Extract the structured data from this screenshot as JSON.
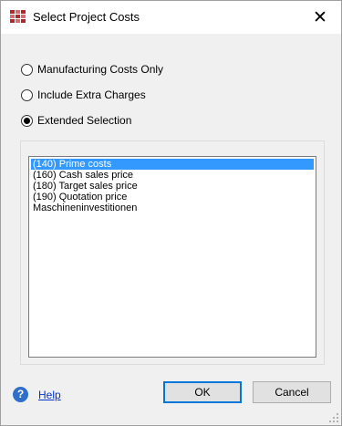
{
  "window": {
    "title": "Select Project Costs",
    "icon": "app-grid-icon",
    "close_glyph": "✕"
  },
  "options": [
    {
      "label": "Manufacturing Costs Only",
      "checked": false
    },
    {
      "label": "Include Extra Charges",
      "checked": false
    },
    {
      "label": "Extended Selection",
      "checked": true
    }
  ],
  "list": {
    "items": [
      {
        "label": "(140) Prime costs",
        "selected": true
      },
      {
        "label": "(160) Cash sales price",
        "selected": false
      },
      {
        "label": "(180) Target sales price",
        "selected": false
      },
      {
        "label": "(190) Quotation price",
        "selected": false
      },
      {
        "label": "Maschineninvestitionen",
        "selected": false
      }
    ]
  },
  "footer": {
    "help_glyph": "?",
    "help_label": "Help",
    "ok_label": "OK",
    "cancel_label": "Cancel"
  },
  "colors": {
    "selection": "#3399ff",
    "link": "#0033cc",
    "accent": "#0078d7",
    "icon_red": "#b3262a"
  }
}
